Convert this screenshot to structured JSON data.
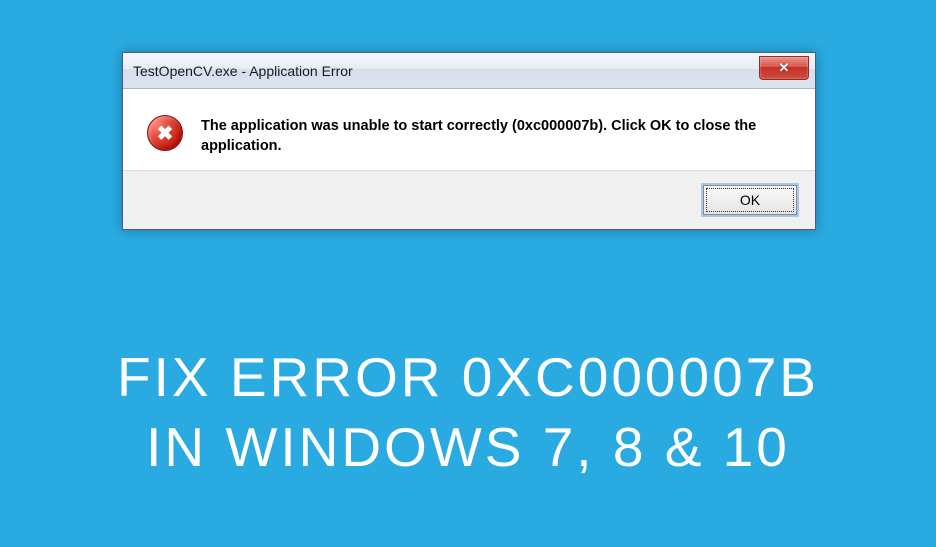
{
  "dialog": {
    "title": "TestOpenCV.exe - Application Error",
    "message": "The application was unable to start correctly (0xc000007b). Click OK to close the application.",
    "ok_label": "OK"
  },
  "headline": {
    "line1": "FIX ERROR 0XC000007B",
    "line2": "IN WINDOWS 7, 8 & 10"
  }
}
